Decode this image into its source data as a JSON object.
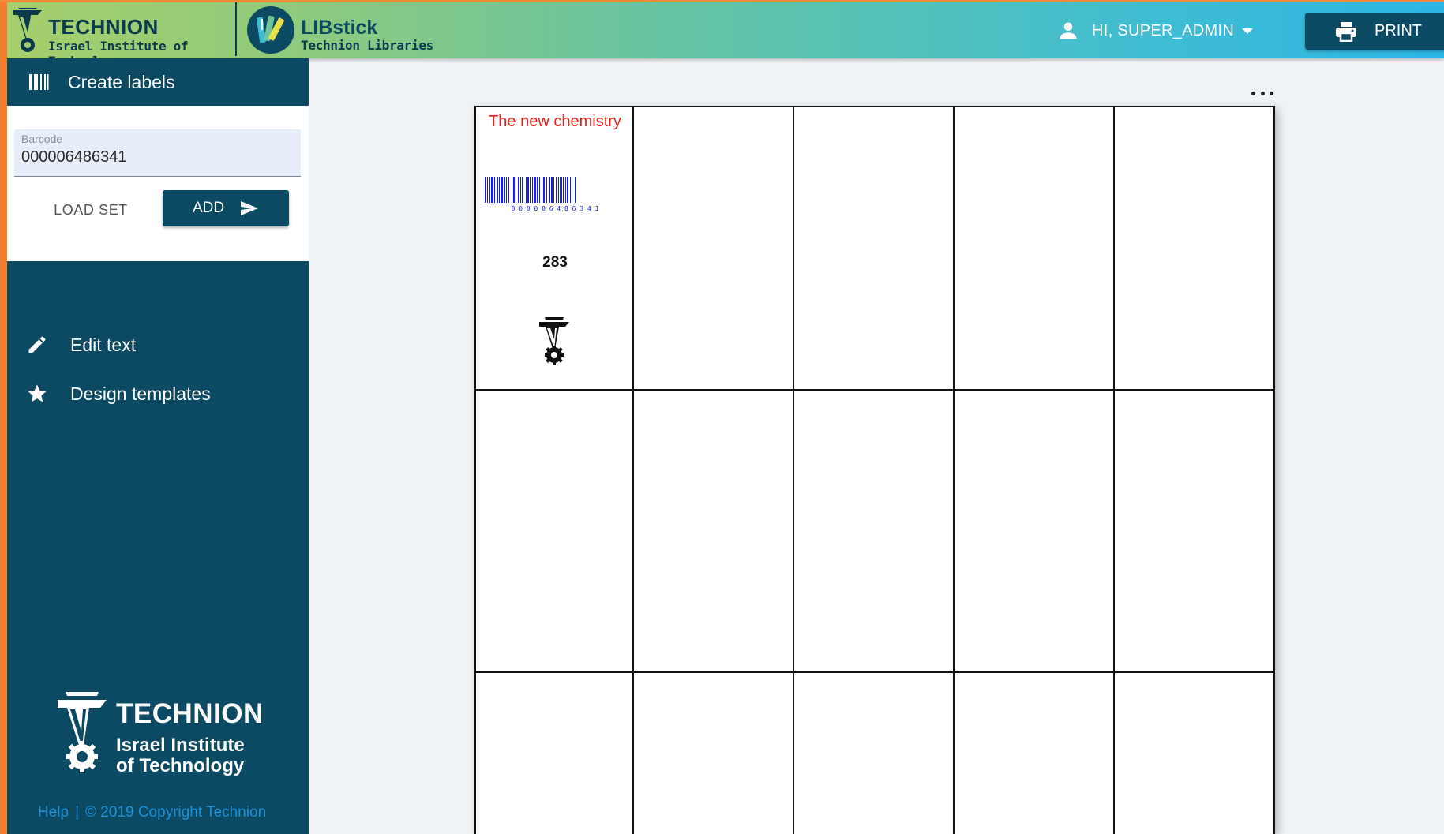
{
  "header": {
    "technion_name": "TECHNION",
    "technion_subtitle": "Israel Institute of Technology",
    "app_name": "LIBstick",
    "app_subtitle": "Technion Libraries",
    "user_greeting": "HI, SUPER_ADMIN",
    "print_label": "PRINT",
    "gradient_start": "#a6cf6c",
    "gradient_end": "#2cb6e6"
  },
  "sidebar": {
    "title": "Create labels",
    "barcode_field": {
      "label": "Barcode",
      "value": "000006486341"
    },
    "load_set_label": "LOAD SET",
    "add_label": "ADD",
    "nav": [
      {
        "label": "Edit text",
        "icon": "pencil-icon"
      },
      {
        "label": "Design templates",
        "icon": "star-icon"
      }
    ],
    "logo": {
      "name": "TECHNION",
      "line2": "Israel Institute",
      "line3": "of Technology"
    },
    "footer": {
      "help": "Help",
      "separator": "|",
      "copyright": "© 2019 Copyright Technion"
    },
    "background": "#0b4a62"
  },
  "sheet": {
    "columns": 5,
    "visible_rows": 3,
    "label": {
      "title": "The new chemistry",
      "barcode_digits": "0 0 0 0 0 6 4 8 6 3 4 1",
      "number": "283",
      "title_color": "#e8211d",
      "barcode_color": "#1a23d8"
    }
  }
}
